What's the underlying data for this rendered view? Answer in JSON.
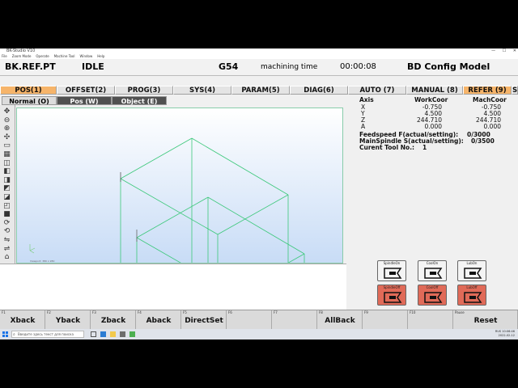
{
  "window": {
    "title": "BK-Studio V10",
    "menu": [
      "File",
      "Zoom Mode",
      "Operate",
      "Machine Tool",
      "Window",
      "Help"
    ]
  },
  "status": {
    "ref": "BK.REF.PT",
    "state": "IDLE",
    "coord": "G54",
    "timer_label": "machining time",
    "timer": "00:00:08",
    "config": "BD Config Model"
  },
  "tabs": [
    {
      "label": "POS(1)",
      "active": true
    },
    {
      "label": "OFFSET(2)",
      "active": false
    },
    {
      "label": "PROG(3)",
      "active": false
    },
    {
      "label": "SYS(4)",
      "active": false
    },
    {
      "label": "PARAM(5)",
      "active": false
    },
    {
      "label": "DIAG(6)",
      "active": false
    },
    {
      "label": "AUTO (7)",
      "active": false
    },
    {
      "label": "MANUAL (8)",
      "active": false
    },
    {
      "label": "REFER (9)",
      "active": true
    },
    {
      "label": "S",
      "active": false
    }
  ],
  "subtabs": [
    {
      "label": "Normal (O)",
      "active": false
    },
    {
      "label": "Pos (W)",
      "active": true
    },
    {
      "label": "Object (E)",
      "active": true
    }
  ],
  "tool_icons": [
    "move-icon",
    "zoom-out-icon",
    "zoom-in-icon",
    "pan-icon",
    "fit-icon",
    "select-icon",
    "cube-icon",
    "cube-iso-icon",
    "cube-front-icon",
    "cube-top-icon",
    "cube-side-icon",
    "cube-back-icon",
    "cube-solid-icon",
    "rotate-icon",
    "rotate2-icon",
    "flip-icon",
    "flip2-icon",
    "reset-view-icon"
  ],
  "view_caption": "Viewport: 380 x 280",
  "axis_table": {
    "headers": [
      "Axis",
      "WorkCoor",
      "MachCoor"
    ],
    "rows": [
      {
        "axis": "X",
        "work": "-0.750",
        "mach": "-0.750"
      },
      {
        "axis": "Y",
        "work": "4.500",
        "mach": "4.500"
      },
      {
        "axis": "Z",
        "work": "244.710",
        "mach": "244.710"
      },
      {
        "axis": "A",
        "work": "0.000",
        "mach": "0.000"
      }
    ]
  },
  "feed": {
    "label": "Feedspeed F(actual/setting):",
    "value": "0/3000"
  },
  "spindle": {
    "label": "MainSpindle S(actual/setting):",
    "value": "0/3500"
  },
  "tool": {
    "label": "Curent Tool No.:",
    "value": "1"
  },
  "func_buttons": [
    {
      "cap": "SpindleOn",
      "style": "light"
    },
    {
      "cap": "CoolOn",
      "style": "light"
    },
    {
      "cap": "LubOn",
      "style": "light"
    },
    {
      "cap": "SpindleOff",
      "style": "red"
    },
    {
      "cap": "CoolOff",
      "style": "red"
    },
    {
      "cap": "LubOff",
      "style": "red"
    }
  ],
  "fkeys": [
    {
      "n": "F1",
      "label": "Xback"
    },
    {
      "n": "F2",
      "label": "Yback"
    },
    {
      "n": "F3",
      "label": "Zback"
    },
    {
      "n": "F4",
      "label": "Aback"
    },
    {
      "n": "F5",
      "label": "DirectSet"
    },
    {
      "n": "F6",
      "label": ""
    },
    {
      "n": "F7",
      "label": ""
    },
    {
      "n": "F8",
      "label": "AllBack"
    },
    {
      "n": "F9",
      "label": ""
    },
    {
      "n": "F10",
      "label": ""
    },
    {
      "n": "Pause",
      "label": "Reset"
    }
  ],
  "taskbar": {
    "search_placeholder": "Введите здесь текст для поиска",
    "time": "10:06:46",
    "date": "2022-02-12",
    "lang": "RUS"
  },
  "colors": {
    "active_tab": "#f6b46a",
    "wire": "#3cc87a",
    "red_btn": "#e06a58"
  }
}
